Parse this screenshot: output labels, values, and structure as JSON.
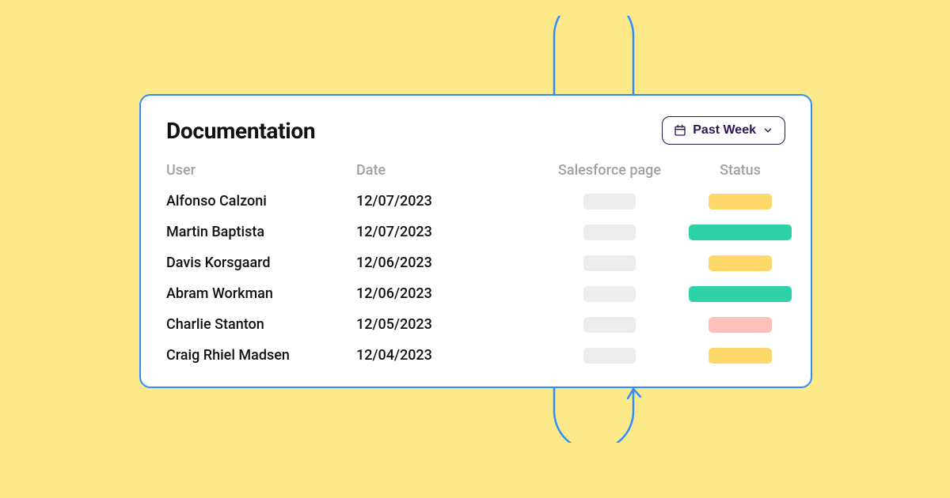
{
  "title": "Documentation",
  "filter": {
    "label": "Past Week"
  },
  "columns": {
    "user": "User",
    "date": "Date",
    "salesforce": "Salesforce page",
    "status": "Status"
  },
  "rows": [
    {
      "user": "Alfonso Calzoni",
      "date": "12/07/2023",
      "status": "yellow"
    },
    {
      "user": "Martin Baptista",
      "date": "12/07/2023",
      "status": "green"
    },
    {
      "user": "Davis Korsgaard",
      "date": "12/06/2023",
      "status": "yellow"
    },
    {
      "user": "Abram Workman",
      "date": "12/06/2023",
      "status": "green"
    },
    {
      "user": "Charlie Stanton",
      "date": "12/05/2023",
      "status": "pink"
    },
    {
      "user": "Craig Rhiel Madsen",
      "date": "12/04/2023",
      "status": "yellow"
    }
  ]
}
